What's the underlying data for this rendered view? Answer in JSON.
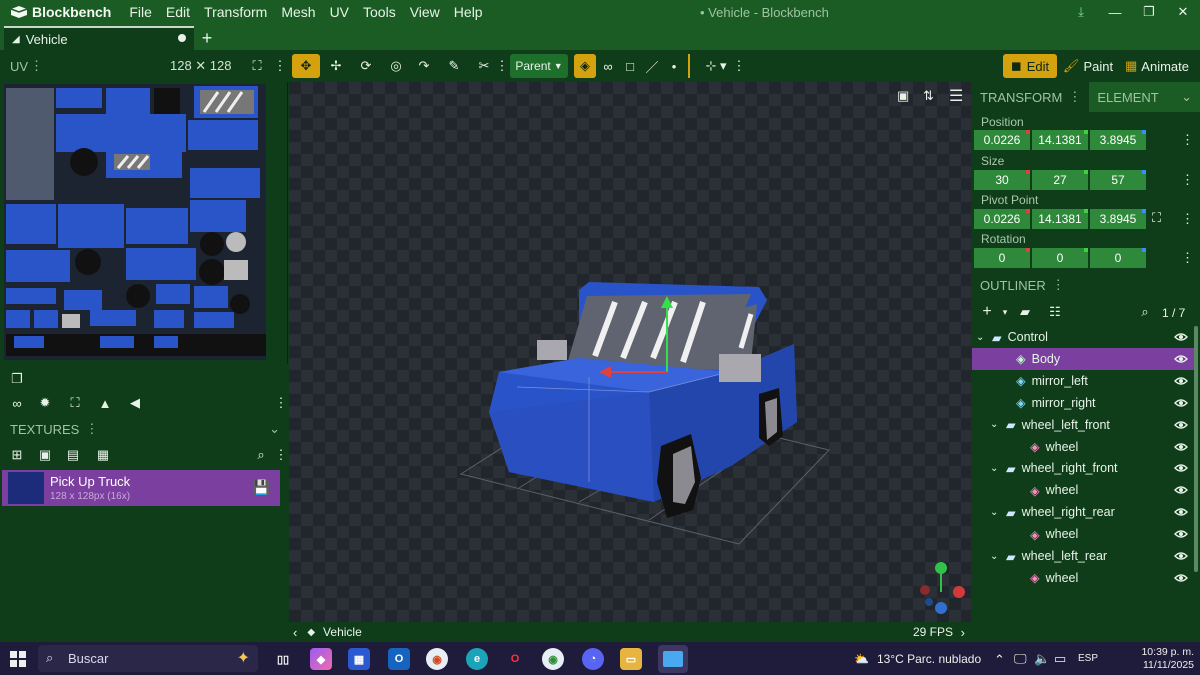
{
  "app": {
    "name": "Blockbench",
    "window_title": "• Vehicle - Blockbench",
    "menu": [
      "File",
      "Edit",
      "Transform",
      "Mesh",
      "UV",
      "Tools",
      "View",
      "Help"
    ]
  },
  "tabs": [
    {
      "label": "Vehicle"
    }
  ],
  "toolbar": {
    "uv_label": "UV",
    "uv_size": "128 ✕ 128",
    "parent_label": "Parent",
    "mode_edit": "Edit",
    "mode_paint": "Paint",
    "mode_animate": "Animate"
  },
  "textures": {
    "header": "TEXTURES",
    "items": [
      {
        "name": "Pick Up Truck",
        "info": "128 x 128px (16x)"
      }
    ]
  },
  "viewport": {
    "name": "Vehicle",
    "fps": "29 FPS"
  },
  "transform": {
    "tab_transform": "TRANSFORM",
    "tab_element": "ELEMENT",
    "position_label": "Position",
    "position": [
      "0.0226",
      "14.1381",
      "3.8945"
    ],
    "size_label": "Size",
    "size": [
      "30",
      "27",
      "57"
    ],
    "pivot_label": "Pivot Point",
    "pivot": [
      "0.0226",
      "14.1381",
      "3.8945"
    ],
    "rotation_label": "Rotation",
    "rotation": [
      "0",
      "0",
      "0"
    ]
  },
  "outliner": {
    "header": "OUTLINER",
    "count": "1 / 7",
    "items": [
      {
        "label": "Control",
        "type": "folder"
      },
      {
        "label": "Body",
        "type": "mesh",
        "selected": true
      },
      {
        "label": "mirror_left",
        "type": "mesh"
      },
      {
        "label": "mirror_right",
        "type": "mesh"
      },
      {
        "label": "wheel_left_front",
        "type": "folder"
      },
      {
        "label": "wheel",
        "type": "cube"
      },
      {
        "label": "wheel_right_front",
        "type": "folder"
      },
      {
        "label": "wheel",
        "type": "cube"
      },
      {
        "label": "wheel_right_rear",
        "type": "folder"
      },
      {
        "label": "wheel",
        "type": "cube"
      },
      {
        "label": "wheel_left_rear",
        "type": "folder"
      },
      {
        "label": "wheel",
        "type": "cube"
      }
    ]
  },
  "taskbar": {
    "search_placeholder": "Buscar",
    "weather": "13°C  Parc. nublado",
    "lang": "ESP",
    "time": "10:39 p. m.",
    "date": "11/11/2025"
  },
  "colors": {
    "accent": "#d4a20f",
    "selection": "#7b3fa0",
    "panel": "#0f3d1a",
    "header": "#1a5c24",
    "car_body": "#2f5fd6"
  }
}
